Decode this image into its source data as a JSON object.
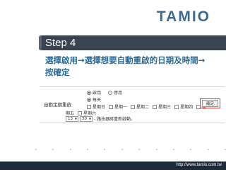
{
  "brand": {
    "logo_text": "TAMIO"
  },
  "step": {
    "label": "Step 4"
  },
  "instruction": {
    "text": "選擇啟用→選擇想要自動重啟的日期及時間→按確定"
  },
  "panel": {
    "label": "自動定期重啟",
    "enable_options": [
      {
        "label": "啟用",
        "selected": true
      },
      {
        "label": "停用",
        "selected": false
      }
    ],
    "schedule_option": {
      "label": "每天",
      "checked": true
    },
    "days": [
      {
        "label": "星期日",
        "checked": false
      },
      {
        "label": "星期一",
        "checked": false
      },
      {
        "label": "星期二",
        "checked": false
      },
      {
        "label": "星期三",
        "checked": false
      },
      {
        "label": "星期四",
        "checked": false
      },
      {
        "label": "星",
        "checked": false
      }
    ],
    "days_row2": [
      {
        "label": "期五",
        "checked": false
      },
      {
        "label": "星期六",
        "checked": false
      }
    ],
    "hour_value": "13",
    "minute_value": "30",
    "time_suffix": "- 路由器將重新啟動。",
    "confirm_label": "確定"
  },
  "footer": {
    "url": "http://www.tamio.com.tw"
  },
  "colors": {
    "step_bar": "#3a4350",
    "instruction": "#2b6a96",
    "highlight": "#d63a3a",
    "footer": "#1e2a38"
  }
}
